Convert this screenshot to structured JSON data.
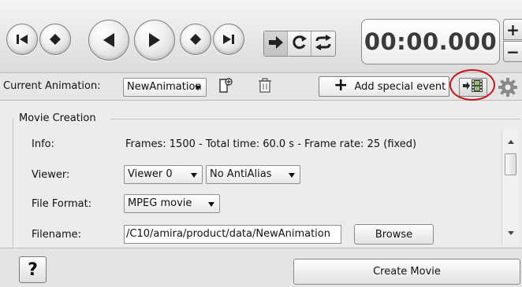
{
  "player": {
    "buttons": [
      {
        "name": "go-to-start",
        "icon": "skip-to-start-icon"
      },
      {
        "name": "previous-keyframe",
        "icon": "diamond-icon"
      },
      {
        "name": "play-backward",
        "icon": "play-backward-icon"
      },
      {
        "name": "play-forward",
        "icon": "play-forward-icon"
      },
      {
        "name": "next-keyframe",
        "icon": "diamond-icon"
      },
      {
        "name": "go-to-end",
        "icon": "skip-to-end-icon"
      }
    ],
    "modes": [
      {
        "name": "once",
        "icon": "arrow-right-icon",
        "active": true
      },
      {
        "name": "loop",
        "icon": "loop-icon",
        "active": false
      },
      {
        "name": "swing",
        "icon": "swing-icon",
        "active": false
      }
    ],
    "time": "00:00.000",
    "spin_up": "+",
    "spin_down": "−"
  },
  "animation": {
    "label": "Current Animation:",
    "selected": "NewAnimation",
    "new_icon": "new-document-icon",
    "delete_icon": "trash-icon",
    "add_event_plus": "+",
    "add_event_label": "Add special event",
    "movie_icon": "film-strip-icon",
    "settings_icon": "gear-icon",
    "highlight_color": "#c8141c"
  },
  "movie_creation": {
    "title": "Movie Creation",
    "info_label": "Info:",
    "info_text": "Frames: 1500 - Total time: 60.0 s - Frame rate: 25 (fixed)",
    "viewer_label": "Viewer:",
    "viewer_value": "Viewer 0",
    "antialias_value": "No AntiAlias",
    "format_label": "File Format:",
    "format_value": "MPEG movie",
    "filename_label": "Filename:",
    "filename_value": "/C10/amira/product/data/NewAnimation",
    "browse_label": "Browse"
  },
  "bottom": {
    "help_label": "?",
    "create_label": "Create Movie"
  }
}
